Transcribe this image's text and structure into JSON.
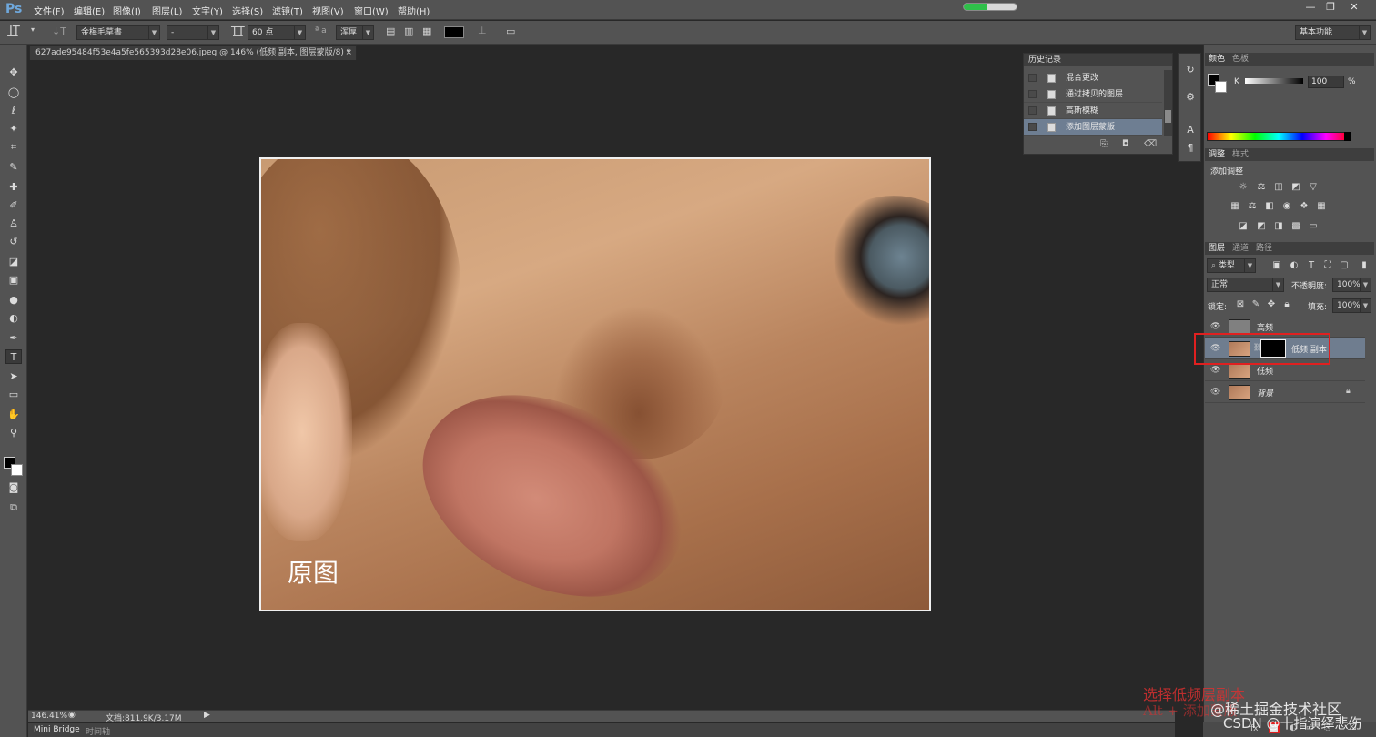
{
  "app": {
    "logo": "Ps"
  },
  "menubar": {
    "items": [
      "文件(F)",
      "编辑(E)",
      "图像(I)",
      "图层(L)",
      "文字(Y)",
      "选择(S)",
      "滤镜(T)",
      "视图(V)",
      "窗口(W)",
      "帮助(H)"
    ],
    "progress_fraction": 0.45,
    "win_min": "—",
    "win_restore": "❐",
    "win_close": "✕"
  },
  "optbar": {
    "tool_icon": "text-tool-icon",
    "font_family": "金梅毛草書",
    "font_style": "-",
    "font_size": "60 点",
    "aa_label": "ª a",
    "antialias": "浑厚",
    "text_color": "#000000",
    "workspace": "基本功能"
  },
  "doc": {
    "tab_title": "627ade95484f53e4a5fe565393d28e06.jpeg @ 146% (低频 副本, 图层蒙版/8) *",
    "photo_label": "原图"
  },
  "status": {
    "zoom": "146.41%",
    "doc_info": "文档:811.9K/3.17M"
  },
  "bottom_tabs": [
    "Mini Bridge",
    "时间轴"
  ],
  "history": {
    "title": "历史记录",
    "items": [
      {
        "label": "混合更改"
      },
      {
        "label": "通过拷贝的图层"
      },
      {
        "label": "高斯模糊"
      },
      {
        "label": "添加图层蒙版"
      }
    ]
  },
  "color_panel": {
    "tabs": [
      "颜色",
      "色板"
    ],
    "channel": "K",
    "value": "100",
    "unit": "%"
  },
  "adjust_panel": {
    "tabs": [
      "调整",
      "样式"
    ],
    "subtitle": "添加调整"
  },
  "layers_panel": {
    "tabs": [
      "图层",
      "通道",
      "路径"
    ],
    "filter_type": "类型",
    "blend_mode": "正常",
    "opacity_label": "不透明度:",
    "opacity": "100%",
    "lock_label": "锁定:",
    "fill_label": "填充:",
    "fill": "100%",
    "layers": [
      {
        "name": "高频",
        "selected": false
      },
      {
        "name": "低频 副本",
        "selected": true
      },
      {
        "name": "低频",
        "selected": false
      },
      {
        "name": "背景",
        "selected": false
      }
    ]
  },
  "watermarks": {
    "red_line1": "选择低频层副本",
    "red_line2": "Alt + 添加蒙版",
    "site": "@稀土掘金技术社区",
    "csdn": "CSDN @十指演绎悲伤"
  }
}
